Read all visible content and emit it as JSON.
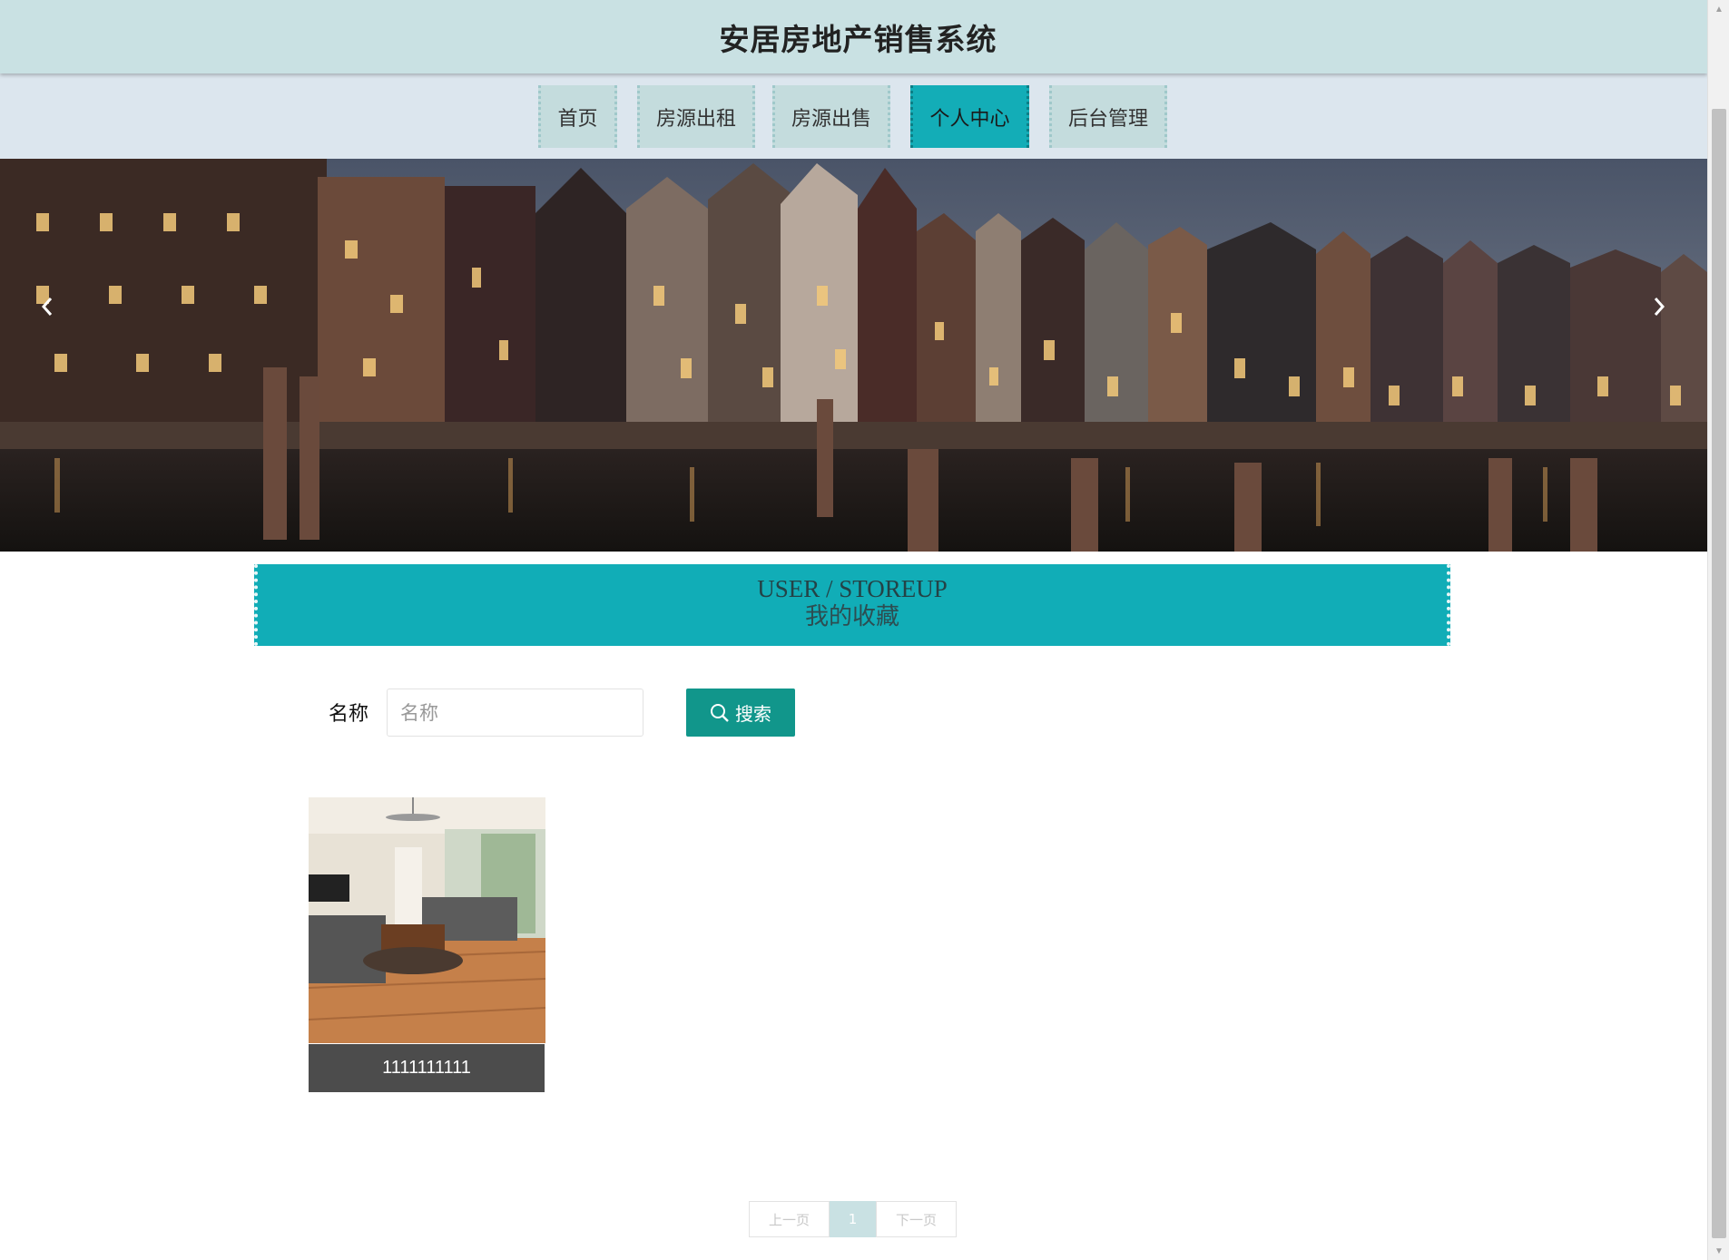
{
  "header": {
    "title": "安居房地产销售系统"
  },
  "nav": {
    "items": [
      {
        "label": "首页",
        "active": false
      },
      {
        "label": "房源出租",
        "active": false
      },
      {
        "label": "房源出售",
        "active": false
      },
      {
        "label": "个人中心",
        "active": true
      },
      {
        "label": "后台管理",
        "active": false
      }
    ]
  },
  "carousel": {
    "prev_icon": "chevron-left-icon",
    "next_icon": "chevron-right-icon"
  },
  "section": {
    "title_en": "USER / STOREUP",
    "title_cn": "我的收藏"
  },
  "search": {
    "label": "名称",
    "placeholder": "名称",
    "value": "",
    "button_label": "搜索",
    "button_icon": "search-icon"
  },
  "favorites": [
    {
      "title": "1111111111"
    }
  ],
  "pagination": {
    "prev_label": "上一页",
    "current_page": "1",
    "next_label": "下一页"
  },
  "colors": {
    "header_bg": "#c9e1e3",
    "nav_bg": "#dce6ee",
    "accent": "#11adb7",
    "search_button": "#11968b"
  }
}
